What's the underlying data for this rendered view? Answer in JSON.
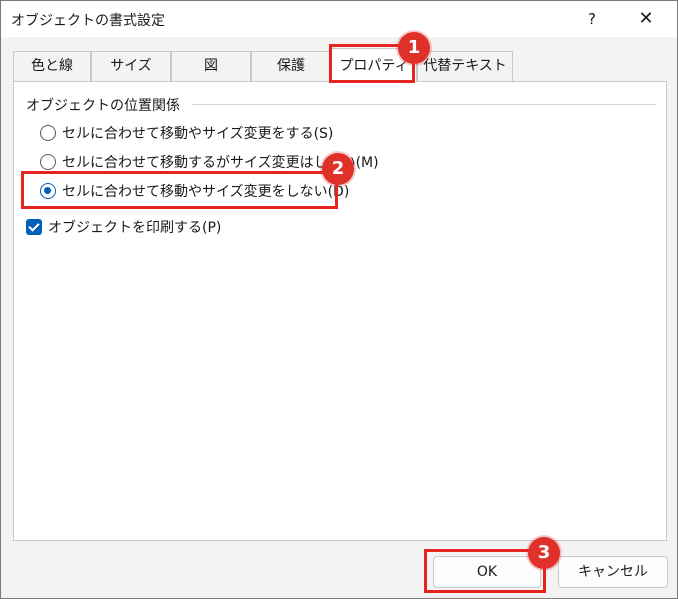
{
  "window": {
    "title": "オブジェクトの書式設定",
    "help_label": "?",
    "close_label": "✕"
  },
  "tabs": [
    {
      "label": "色と線"
    },
    {
      "label": "サイズ"
    },
    {
      "label": "図"
    },
    {
      "label": "保護"
    },
    {
      "label": "プロパティ",
      "active": true
    },
    {
      "label": "代替テキスト"
    }
  ],
  "group": {
    "label": "オブジェクトの位置関係"
  },
  "options": [
    {
      "label": "セルに合わせて移動やサイズ変更をする(S)",
      "checked": false
    },
    {
      "label": "セルに合わせて移動するがサイズ変更はしない(M)",
      "checked": false
    },
    {
      "label": "セルに合わせて移動やサイズ変更をしない(D)",
      "checked": true
    }
  ],
  "print_option": {
    "label": "オブジェクトを印刷する(P)",
    "checked": true
  },
  "buttons": {
    "ok_label": "OK",
    "cancel_label": "キャンセル"
  },
  "annotations": {
    "badge1": "1",
    "badge2": "2",
    "badge3": "3",
    "color": "#e5231f"
  }
}
